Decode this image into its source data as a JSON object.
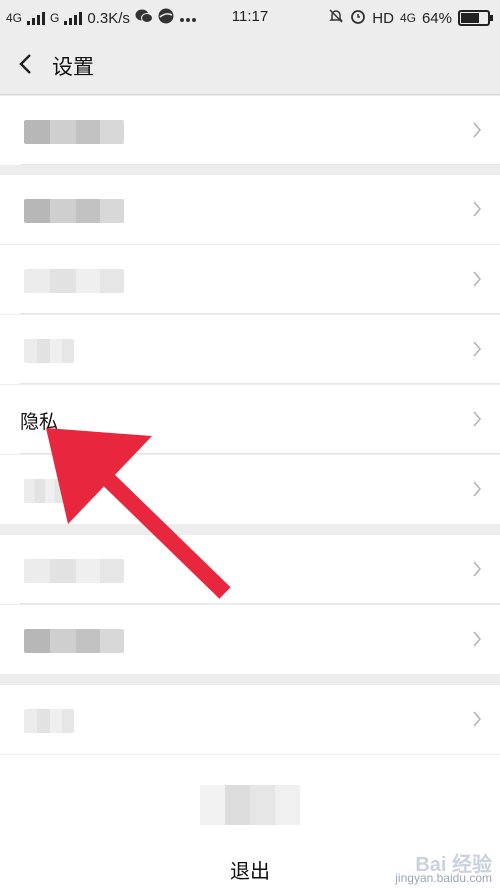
{
  "status_bar": {
    "network_1": "4G",
    "network_2": "G",
    "speed": "0.3K/s",
    "time": "11:17",
    "hd": "HD",
    "network_3": "4G",
    "battery_percent": "64%",
    "battery_level": 0.64,
    "icons": [
      "wechat-icon",
      "browser-icon",
      "more-dots-icon",
      "mute-alarm-icon",
      "alarm-clock-icon",
      "battery-icon"
    ]
  },
  "header": {
    "title": "设置",
    "back_icon": "chevron-left-icon"
  },
  "settings": {
    "items": [
      {
        "label": ""
      },
      {
        "label": ""
      },
      {
        "label": ""
      },
      {
        "label": ""
      },
      {
        "label": "隐私"
      },
      {
        "label": ""
      },
      {
        "label": ""
      },
      {
        "label": ""
      },
      {
        "label": ""
      }
    ]
  },
  "logout": {
    "label": "退出"
  },
  "annotation": {
    "arrow_color": "#e8273f"
  },
  "watermark": {
    "text": "Bai 经验",
    "url": "jingyan.baidu.com"
  }
}
